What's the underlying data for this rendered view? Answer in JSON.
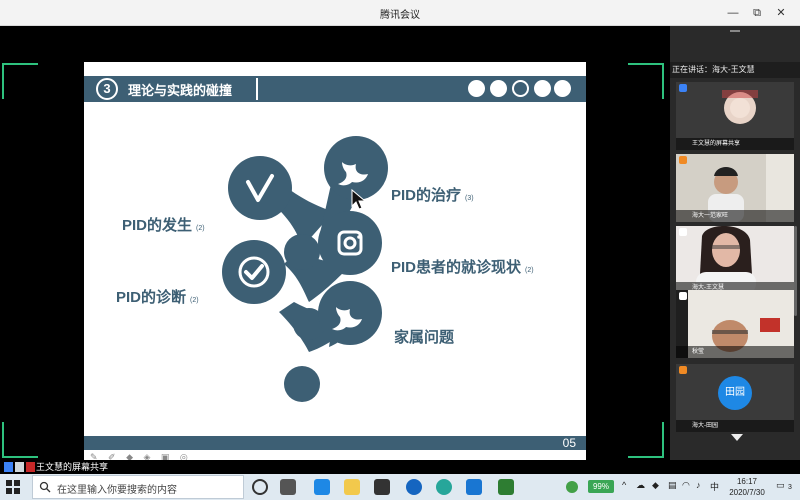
{
  "window": {
    "title": "腾讯会议",
    "minimize": "—",
    "maximize": "⧉",
    "close": "✕"
  },
  "slide": {
    "section_number": "3",
    "section_title": "理论与实践的碰撞",
    "page_number": "05",
    "items": [
      {
        "label": "PID的发生",
        "count": "(2)"
      },
      {
        "label": "PID的诊断",
        "count": "(2)"
      },
      {
        "label": "PID的治疗",
        "count": "(3)"
      },
      {
        "label": "PID患者的就诊现状",
        "count": "(2)"
      },
      {
        "label": "家属问题",
        "count": ""
      }
    ],
    "icons": [
      "vimeo-icon",
      "check-icon",
      "twitter-icon",
      "instagram-icon",
      "twitter-icon"
    ],
    "accent_color": "#3d5f74"
  },
  "panel": {
    "speaker_label": "正在讲话：海大-王文慧",
    "participants": [
      {
        "name": "王文慧的屏幕共享"
      },
      {
        "name": "海大一范家旺"
      },
      {
        "name": "海大-王文慧"
      },
      {
        "name": "秋莹"
      },
      {
        "name": "海大-田园",
        "avatar_text": "田园"
      }
    ]
  },
  "share_status": "王文慧的屏幕共享",
  "taskbar": {
    "search_placeholder": "在这里输入你要搜索的内容",
    "battery": "99%",
    "ime": "中",
    "time": "16:17",
    "date": "2020/7/30",
    "notifications": "3"
  }
}
